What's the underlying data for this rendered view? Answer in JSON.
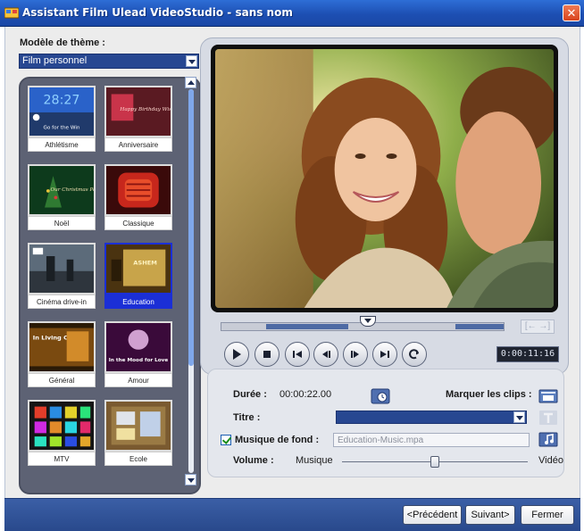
{
  "window": {
    "title": "Assistant Film Ulead VideoStudio - sans nom",
    "close_label": "✕"
  },
  "theme": {
    "label": "Modèle de thème :",
    "selected": "Film personnel"
  },
  "templates": [
    {
      "name": "Athlétisme",
      "selected": false,
      "art_text": "Go for the Win",
      "clock_text": "28:27"
    },
    {
      "name": "Anniversaire",
      "selected": false,
      "art_text": "Happy Birthday Wishes"
    },
    {
      "name": "Noël",
      "selected": false,
      "art_text": "Our Christmas Party"
    },
    {
      "name": "Classique",
      "selected": false
    },
    {
      "name": "Cinéma drive-in",
      "selected": false
    },
    {
      "name": "Education",
      "selected": true,
      "art_text": "ASHEM"
    },
    {
      "name": "Général",
      "selected": false,
      "art_text": "In Living Colors"
    },
    {
      "name": "Amour",
      "selected": false,
      "art_text": "In the Mood for Love"
    },
    {
      "name": "MTV",
      "selected": false
    },
    {
      "name": "Ecole",
      "selected": false
    }
  ],
  "preview": {
    "timecode": "0:00:11:16",
    "nav_arrows": "[← →]"
  },
  "settings": {
    "duree_label": "Durée :",
    "duree_value": "00:00:22.00",
    "marquer_label": "Marquer les clips :",
    "titre_label": "Titre :",
    "musique_label": "Musique de fond :",
    "musique_value": "Education-Music.mpa",
    "musique_checked": true,
    "volume_label": "Volume :",
    "volume_left": "Musique",
    "volume_right": "Vidéo",
    "volume_level": 0.5
  },
  "buttons": {
    "prev": "<Précédent",
    "next": "Suivant>",
    "close": "Fermer"
  },
  "colors": {
    "titlebar": "#1d4fb3",
    "accent": "#274791",
    "selected_template": "#1b2fd6"
  }
}
